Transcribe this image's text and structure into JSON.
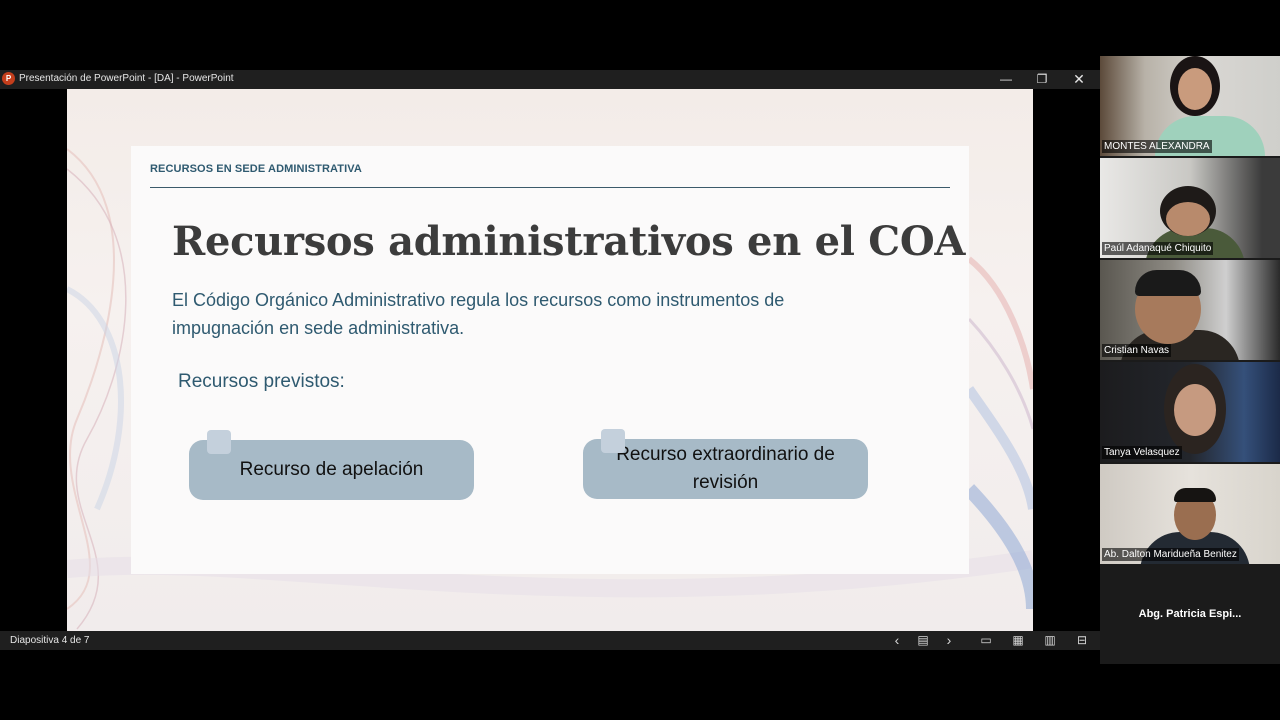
{
  "window": {
    "title": "Presentación de PowerPoint - [DA] - PowerPoint",
    "app_icon_letter": "P",
    "minimize_glyph": "—",
    "restore_glyph": "❐",
    "close_glyph": "✕"
  },
  "slide": {
    "header_label": "RECURSOS EN SEDE ADMINISTRATIVA",
    "title": "Recursos administrativos en el COA",
    "body": "El Código Orgánico Administrativo regula los recursos como instrumentos de impugnación en sede administrativa.",
    "subtitle": "Recursos previstos:",
    "pills": [
      "Recurso de apelación",
      "Recurso extraordinario de revisión"
    ]
  },
  "statusbar": {
    "slide_counter": "Diapositiva 4 de 7",
    "icons": {
      "prev": "‹",
      "notes": "▤",
      "next": "›",
      "normal_view": "▭",
      "sorter_view": "▦",
      "reading_view": "▥",
      "slideshow": "⊟"
    }
  },
  "participants": [
    {
      "name": "MONTES ALEXANDRA"
    },
    {
      "name": "Paúl Adanaqué Chiquito"
    },
    {
      "name": "Cristian Navas"
    },
    {
      "name": "Tanya Velasquez"
    },
    {
      "name": "Ab. Dalton Maridueña Benitez"
    },
    {
      "name": "Abg. Patricia Espi..."
    }
  ],
  "colors": {
    "accent_text": "#2f5a70",
    "pill_fill": "#a7bac7",
    "powerpoint_brand": "#c43e1c"
  }
}
